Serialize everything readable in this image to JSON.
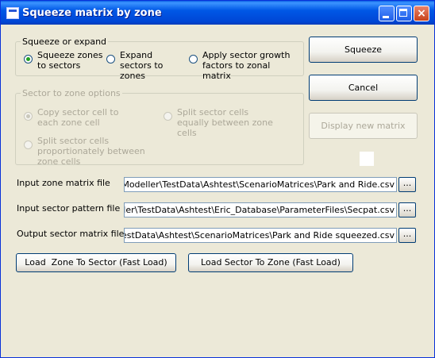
{
  "window": {
    "title": "Squeeze matrix by zone",
    "minimize_glyph": "",
    "close_glyph": "×"
  },
  "squeeze_group": {
    "legend": "Squeeze or expand",
    "options": [
      {
        "label": "Squeeze zones to sectors",
        "selected": true
      },
      {
        "label": "Expand sectors to zones",
        "selected": false
      },
      {
        "label": "Apply sector growth factors to zonal matrix",
        "selected": false
      }
    ]
  },
  "sector_group": {
    "legend": "Sector to zone options",
    "disabled": true,
    "options": [
      {
        "label": "Copy sector cell to each zone cell",
        "selected": true
      },
      {
        "label": "Split sector cells equally between zone cells",
        "selected": false
      },
      {
        "label": "Split sector cells proportionately between zone cells",
        "selected": false
      }
    ]
  },
  "buttons": {
    "squeeze": "Squeeze",
    "cancel": "Cancel",
    "display": "Display new matrix",
    "load_zone_to_sector": "Load  Zone To Sector (Fast Load)",
    "load_sector_to_zone": "Load Sector To Zone (Fast Load)",
    "browse": "..."
  },
  "files": {
    "input_zone": {
      "label": "Input zone matrix file",
      "value": "Transport Modeller\\TestData\\Ashtest\\ScenarioMatrices\\Park and Ride.csv"
    },
    "input_sector": {
      "label": "Input sector pattern file",
      "value": "Transport Modeller\\TestData\\Ashtest\\Eric_Database\\ParameterFiles\\Secpat.csv"
    },
    "output_sector": {
      "label": "Output sector matrix file",
      "value": "Transport Modeller\\TestData\\Ashtest\\ScenarioMatrices\\Park and Ride squeezed.csv"
    }
  },
  "colors": {
    "titlebar": "#0058e6",
    "face": "#ece9d8",
    "radio_selected": "#21a121",
    "disabled_text": "#aca899"
  }
}
